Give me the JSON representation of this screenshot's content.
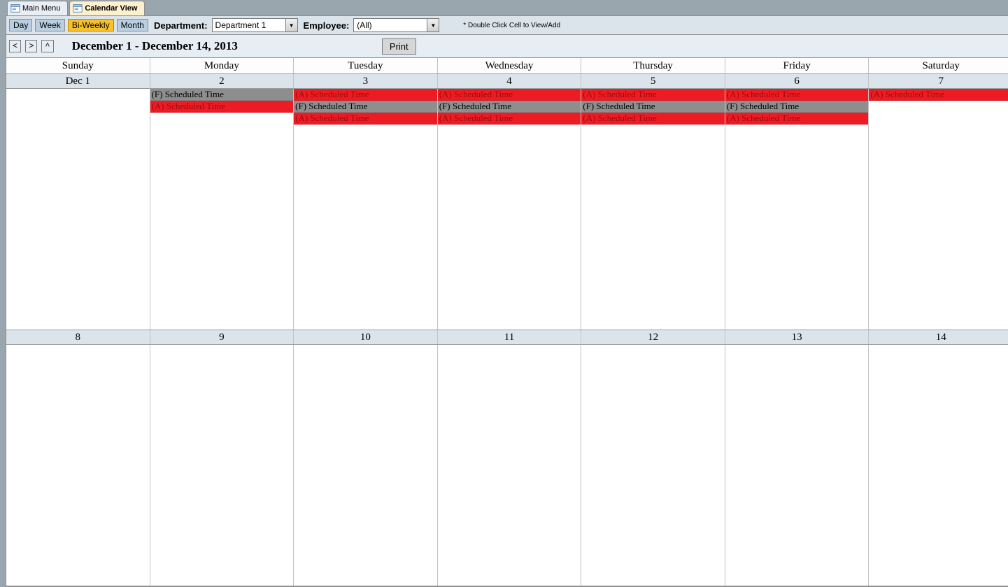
{
  "tabs": [
    {
      "label": "Main Menu",
      "active": false
    },
    {
      "label": "Calendar View",
      "active": true
    }
  ],
  "toolbar": {
    "views": [
      {
        "id": "day",
        "label": "Day",
        "active": false
      },
      {
        "id": "week",
        "label": "Week",
        "active": false
      },
      {
        "id": "biweekly",
        "label": "Bi-Weekly",
        "active": true
      },
      {
        "id": "month",
        "label": "Month",
        "active": false
      }
    ],
    "department_label": "Department:",
    "department_value": "Department 1",
    "employee_label": "Employee:",
    "employee_value": "(All)",
    "hint": "* Double Click Cell to View/Add",
    "nav_prev": "<",
    "nav_next": ">",
    "nav_up": "^",
    "date_range": "December 1 - December 14, 2013",
    "print_label": "Print"
  },
  "calendar": {
    "day_names": [
      "Sunday",
      "Monday",
      "Tuesday",
      "Wednesday",
      "Thursday",
      "Friday",
      "Saturday"
    ],
    "weeks": [
      {
        "dates": [
          "Dec 1",
          "2",
          "3",
          "4",
          "5",
          "6",
          "7"
        ],
        "cells": [
          {
            "events": []
          },
          {
            "events": [
              {
                "text": "(F) Scheduled Time",
                "style": "gray"
              },
              {
                "text": "(A) Scheduled Time",
                "style": "red"
              }
            ]
          },
          {
            "events": [
              {
                "text": "(A) Scheduled Time",
                "style": "red"
              },
              {
                "text": "(F) Scheduled Time",
                "style": "gray"
              },
              {
                "text": "(A) Scheduled Time",
                "style": "red"
              }
            ]
          },
          {
            "events": [
              {
                "text": "(A) Scheduled Time",
                "style": "red"
              },
              {
                "text": "(F) Scheduled Time",
                "style": "gray"
              },
              {
                "text": "(A) Scheduled Time",
                "style": "red"
              }
            ]
          },
          {
            "events": [
              {
                "text": "(A) Scheduled Time",
                "style": "red"
              },
              {
                "text": "(F) Scheduled Time",
                "style": "gray"
              },
              {
                "text": "(A) Scheduled Time",
                "style": "red"
              }
            ]
          },
          {
            "events": [
              {
                "text": "(A) Scheduled Time",
                "style": "red"
              },
              {
                "text": "(F) Scheduled Time",
                "style": "gray"
              },
              {
                "text": "(A) Scheduled Time",
                "style": "red"
              }
            ]
          },
          {
            "events": [
              {
                "text": "(A) Scheduled Time",
                "style": "red"
              }
            ]
          }
        ]
      },
      {
        "dates": [
          "8",
          "9",
          "10",
          "11",
          "12",
          "13",
          "14"
        ],
        "cells": [
          {
            "events": []
          },
          {
            "events": []
          },
          {
            "events": []
          },
          {
            "events": []
          },
          {
            "events": []
          },
          {
            "events": []
          },
          {
            "events": []
          }
        ]
      }
    ]
  }
}
